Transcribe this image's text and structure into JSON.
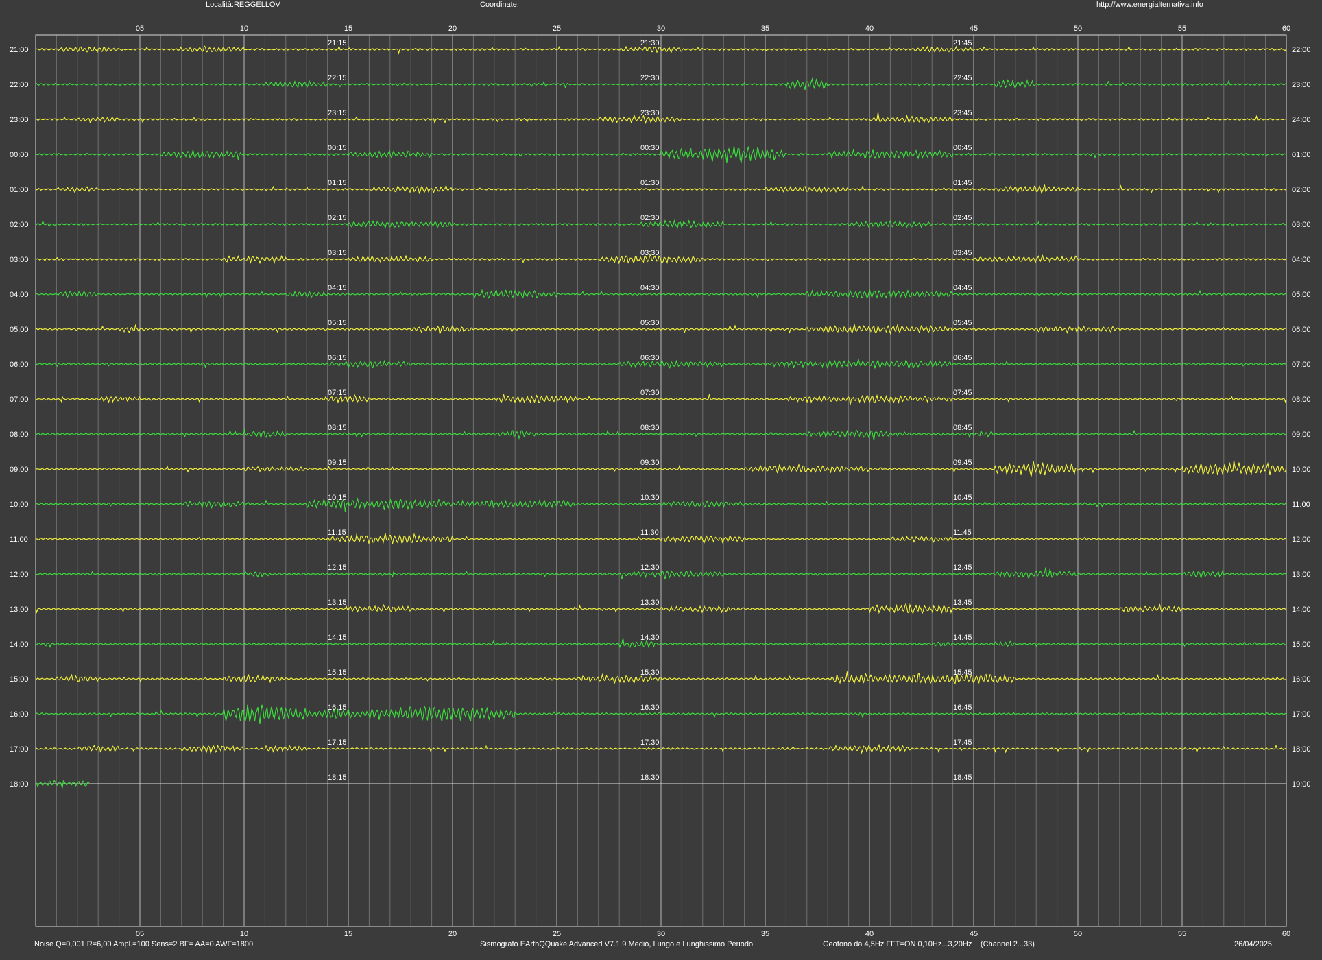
{
  "header": {
    "location": "Località:REGGELLOV",
    "coordinates": "Coordinate:",
    "url": "http://www.energialternativa.info"
  },
  "footer": {
    "params": "Noise Q=0,001 R=6,00 Ampl.=100 Sens=2 BF= AA=0 AWF=1800",
    "software": "Sismografo  EArthQQuake Advanced V7.1.9  Medio, Lungo e Lunghissimo Periodo",
    "geofono": "Geofono da 4,5Hz FFT=ON 0,10Hz...3,20Hz",
    "channel": "(Channel 2...33)",
    "date": "26/04/2025"
  },
  "colors": {
    "background": "#3b3b3b",
    "trace_odd": "#f0f03c",
    "trace_even": "#3cdc3c",
    "grid_minor": "#707070",
    "grid_major": "#b8b8b8",
    "frame": "#d8d8d8",
    "text": "#ffffff"
  },
  "chart_data": {
    "type": "line",
    "xlim": [
      0,
      60
    ],
    "x_ticks": [
      "05",
      "10",
      "15",
      "20",
      "25",
      "30",
      "35",
      "40",
      "45",
      "50",
      "55",
      "60"
    ],
    "minor_tick_step_minutes": 1,
    "major_tick_step_minutes": 5,
    "rows": [
      {
        "start": "21:00",
        "end": "22:00",
        "marks": [
          "21:15",
          "21:30",
          "21:45"
        ],
        "color": "yellow",
        "activity": [
          [
            1,
            4,
            1.0
          ],
          [
            7,
            10,
            1.3
          ],
          [
            28,
            31,
            1.2
          ],
          [
            42,
            45,
            1.2
          ]
        ]
      },
      {
        "start": "22:00",
        "end": "23:00",
        "marks": [
          "22:15",
          "22:30",
          "22:45"
        ],
        "color": "green",
        "activity": [
          [
            11,
            14,
            1.4
          ],
          [
            36,
            38,
            2.5
          ],
          [
            46,
            48,
            2.0
          ]
        ]
      },
      {
        "start": "23:00",
        "end": "24:00",
        "marks": [
          "23:15",
          "23:30",
          "23:45"
        ],
        "color": "yellow",
        "activity": [
          [
            2,
            4,
            1.0
          ],
          [
            27,
            31,
            1.5
          ],
          [
            40,
            44,
            1.3
          ]
        ]
      },
      {
        "start": "00:00",
        "end": "01:00",
        "marks": [
          "00:15",
          "00:30",
          "00:45"
        ],
        "color": "green",
        "activity": [
          [
            6,
            10,
            1.5
          ],
          [
            15,
            19,
            1.3
          ],
          [
            30,
            36,
            3.5
          ],
          [
            38,
            44,
            2.2
          ]
        ]
      },
      {
        "start": "01:00",
        "end": "02:00",
        "marks": [
          "01:15",
          "01:30",
          "01:45"
        ],
        "color": "yellow",
        "activity": [
          [
            1,
            3,
            1.0
          ],
          [
            16,
            20,
            1.3
          ],
          [
            35,
            39,
            1.2
          ],
          [
            46,
            50,
            1.4
          ]
        ]
      },
      {
        "start": "02:00",
        "end": "03:00",
        "marks": [
          "02:15",
          "02:30",
          "02:45"
        ],
        "color": "green",
        "activity": [
          [
            15,
            20,
            1.4
          ],
          [
            29,
            33,
            1.5
          ],
          [
            39,
            43,
            1.2
          ]
        ]
      },
      {
        "start": "03:00",
        "end": "04:00",
        "marks": [
          "03:15",
          "03:30",
          "03:45"
        ],
        "color": "yellow",
        "activity": [
          [
            9,
            12,
            1.5
          ],
          [
            15,
            19,
            1.4
          ],
          [
            27,
            32,
            1.8
          ],
          [
            45,
            50,
            1.3
          ]
        ]
      },
      {
        "start": "04:00",
        "end": "05:00",
        "marks": [
          "04:15",
          "04:30",
          "04:45"
        ],
        "color": "green",
        "activity": [
          [
            1,
            3,
            1.4
          ],
          [
            12,
            14,
            1.3
          ],
          [
            21,
            25,
            1.5
          ],
          [
            37,
            44,
            1.6
          ]
        ]
      },
      {
        "start": "05:00",
        "end": "06:00",
        "marks": [
          "05:15",
          "05:30",
          "05:45"
        ],
        "color": "yellow",
        "activity": [
          [
            4,
            5,
            1.0
          ],
          [
            18,
            21,
            1.2
          ],
          [
            37,
            44,
            1.6
          ],
          [
            48,
            52,
            1.2
          ]
        ]
      },
      {
        "start": "06:00",
        "end": "07:00",
        "marks": [
          "06:15",
          "06:30",
          "06:45"
        ],
        "color": "green",
        "activity": [
          [
            14,
            18,
            1.3
          ],
          [
            28,
            33,
            1.3
          ],
          [
            35,
            44,
            1.7
          ]
        ]
      },
      {
        "start": "07:00",
        "end": "08:00",
        "marks": [
          "07:15",
          "07:30",
          "07:45"
        ],
        "color": "yellow",
        "activity": [
          [
            3,
            5,
            1.3
          ],
          [
            14,
            16,
            1.5
          ],
          [
            22,
            26,
            1.7
          ],
          [
            36,
            44,
            1.4
          ]
        ]
      },
      {
        "start": "08:00",
        "end": "09:00",
        "marks": [
          "08:15",
          "08:30",
          "08:45"
        ],
        "color": "green",
        "activity": [
          [
            10,
            12,
            1.3
          ],
          [
            22,
            24,
            1.6
          ],
          [
            37,
            42,
            1.6
          ],
          [
            45,
            46,
            1.3
          ]
        ]
      },
      {
        "start": "09:00",
        "end": "10:00",
        "marks": [
          "09:15",
          "09:30",
          "09:45"
        ],
        "color": "yellow",
        "activity": [
          [
            10,
            13,
            1.1
          ],
          [
            34,
            40,
            1.5
          ],
          [
            46,
            50,
            3.0
          ],
          [
            55,
            60,
            3.2
          ]
        ]
      },
      {
        "start": "10:00",
        "end": "11:00",
        "marks": [
          "10:15",
          "10:30",
          "10:45"
        ],
        "color": "green",
        "activity": [
          [
            7,
            10,
            1.4
          ],
          [
            13,
            20,
            2.4
          ],
          [
            20,
            26,
            1.8
          ],
          [
            30,
            34,
            1.2
          ]
        ]
      },
      {
        "start": "11:00",
        "end": "12:00",
        "marks": [
          "11:15",
          "11:30",
          "11:45"
        ],
        "color": "yellow",
        "activity": [
          [
            14,
            20,
            2.0
          ],
          [
            30,
            34,
            1.4
          ],
          [
            41,
            44,
            1.2
          ]
        ]
      },
      {
        "start": "12:00",
        "end": "13:00",
        "marks": [
          "12:15",
          "12:30",
          "12:45"
        ],
        "color": "green",
        "activity": [
          [
            10,
            11,
            1.5
          ],
          [
            28,
            33,
            1.3
          ],
          [
            46,
            50,
            1.5
          ],
          [
            55,
            57,
            1.3
          ]
        ]
      },
      {
        "start": "13:00",
        "end": "14:00",
        "marks": [
          "13:15",
          "13:30",
          "13:45"
        ],
        "color": "yellow",
        "activity": [
          [
            15,
            18,
            1.2
          ],
          [
            30,
            34,
            1.2
          ],
          [
            40,
            44,
            2.2
          ],
          [
            52,
            55,
            1.8
          ]
        ]
      },
      {
        "start": "14:00",
        "end": "15:00",
        "marks": [
          "14:15",
          "14:30",
          "14:45"
        ],
        "color": "green",
        "activity": [
          [
            28,
            30,
            1.6
          ],
          [
            43,
            44,
            1.2
          ],
          [
            46,
            47,
            1.2
          ]
        ]
      },
      {
        "start": "15:00",
        "end": "16:00",
        "marks": [
          "15:15",
          "15:30",
          "15:45"
        ],
        "color": "yellow",
        "activity": [
          [
            1,
            3,
            1.2
          ],
          [
            9,
            12,
            1.5
          ],
          [
            26,
            30,
            1.6
          ],
          [
            38,
            47,
            2.4
          ]
        ]
      },
      {
        "start": "16:00",
        "end": "17:00",
        "marks": [
          "16:15",
          "16:30",
          "16:45"
        ],
        "color": "green",
        "activity": [
          [
            9,
            13,
            4.2
          ],
          [
            13,
            16,
            2.0
          ],
          [
            16,
            23,
            3.5
          ]
        ]
      },
      {
        "start": "17:00",
        "end": "18:00",
        "marks": [
          "17:15",
          "17:30",
          "17:45"
        ],
        "color": "yellow",
        "activity": [
          [
            2,
            4,
            1.2
          ],
          [
            7,
            10,
            1.4
          ],
          [
            11,
            13,
            1.2
          ],
          [
            38,
            42,
            1.4
          ]
        ]
      },
      {
        "start": "18:00",
        "end": "19:00",
        "marks": [
          "18:15",
          "18:30",
          "18:45"
        ],
        "color": "green",
        "activity": [
          [
            0,
            2.6,
            1.5
          ]
        ],
        "recorded_until_minute": 2.6
      }
    ]
  }
}
